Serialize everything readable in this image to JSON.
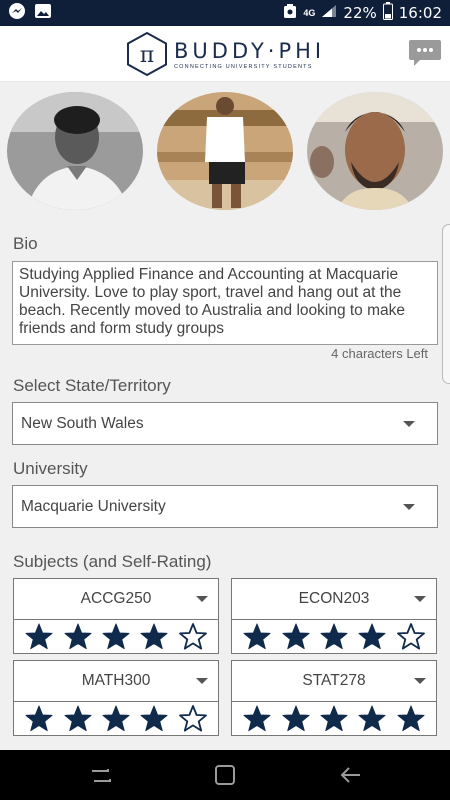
{
  "status_bar": {
    "icons": [
      "messenger-icon",
      "gallery-icon",
      "data-saver-icon",
      "signal-icon",
      "battery-icon"
    ],
    "network": "4G",
    "battery": "22%",
    "time": "16:02"
  },
  "header": {
    "logo_symbol": "π",
    "title": "BUDDY·PHI",
    "tagline": "CONNECTING UNIVERSITY STUDENTS",
    "chat_icon": "chat-icon",
    "brand_color": "#1a2b4c"
  },
  "profile": {
    "photos": [
      "profile-photo-1",
      "profile-photo-2",
      "profile-photo-3"
    ],
    "bio_label": "Bio",
    "bio_text": "Studying Applied Finance and Accounting at Macquarie University. Love to play sport, travel and hang out at the beach. Recently moved to Australia and looking to make friends and form study groups",
    "char_count": "4 characters Left",
    "state_label": "Select State/Territory",
    "state_value": "New South Wales",
    "university_label": "University",
    "university_value": "Macquarie University",
    "subjects_label": "Subjects (and Self-Rating)",
    "subjects": [
      {
        "code": "ACCG250",
        "rating": 4
      },
      {
        "code": "ECON203",
        "rating": 4
      },
      {
        "code": "MATH300",
        "rating": 4
      },
      {
        "code": "STAT278",
        "rating": 5
      }
    ],
    "star_color": "#102a4c"
  },
  "nav": {
    "recent": "recent-apps-icon",
    "home": "home-icon",
    "back": "back-icon"
  }
}
